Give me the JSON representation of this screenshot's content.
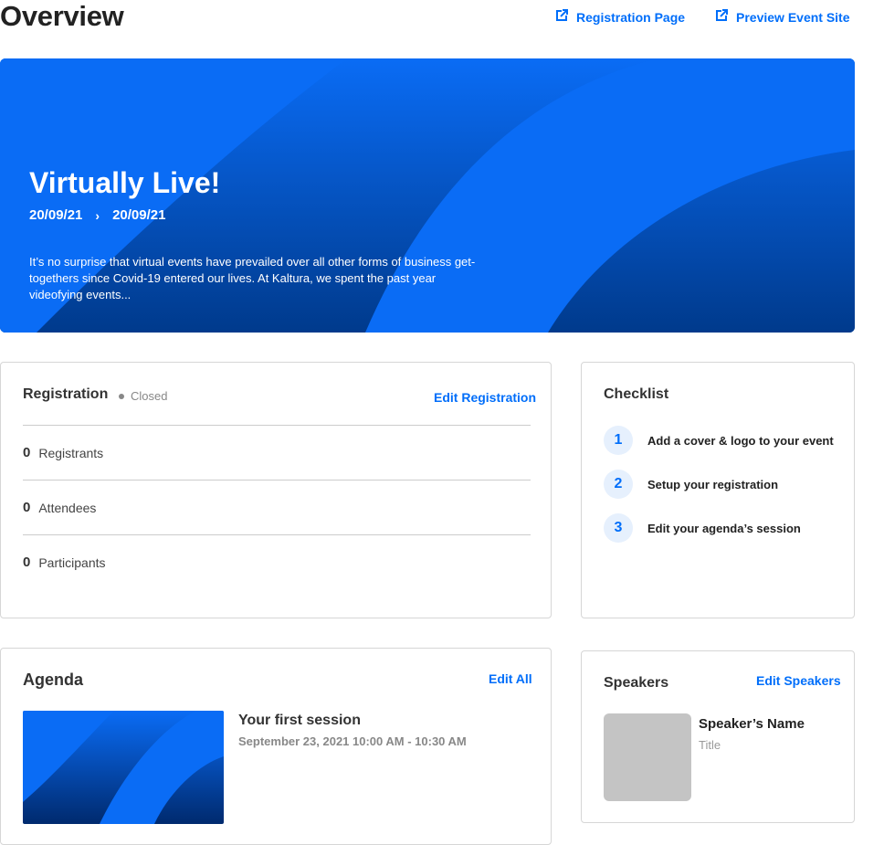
{
  "header": {
    "title": "Overview",
    "registration_link": "Registration Page",
    "preview_link": "Preview Event Site"
  },
  "hero": {
    "title": "Virtually Live!",
    "start_date": "20/09/21",
    "end_date": "20/09/21",
    "description": "It’s no surprise that virtual events have prevailed over all other forms of business get-togethers since Covid-19 entered our lives. At Kaltura, we spent the past year videofying events..."
  },
  "registration": {
    "title": "Registration",
    "status": "Closed",
    "edit_label": "Edit Registration",
    "stats": [
      {
        "value": "0",
        "label": "Registrants"
      },
      {
        "value": "0",
        "label": "Attendees"
      },
      {
        "value": "0",
        "label": "Participants"
      }
    ]
  },
  "checklist": {
    "title": "Checklist",
    "items": [
      {
        "number": "1",
        "label": "Add a cover & logo to your event"
      },
      {
        "number": "2",
        "label": "Setup your registration"
      },
      {
        "number": "3",
        "label": "Edit your agenda’s session"
      }
    ]
  },
  "agenda": {
    "title": "Agenda",
    "edit_label": "Edit All",
    "session": {
      "title": "Your first session",
      "time": "September 23, 2021  10:00 AM - 10:30 AM"
    }
  },
  "speakers": {
    "title": "Speakers",
    "edit_label": "Edit Speakers",
    "speaker": {
      "name": "Speaker’s Name",
      "role": "Title"
    }
  },
  "colors": {
    "accent": "#006efa",
    "hero_dark": "#003a8c",
    "hero_light": "#0a6cf5"
  }
}
